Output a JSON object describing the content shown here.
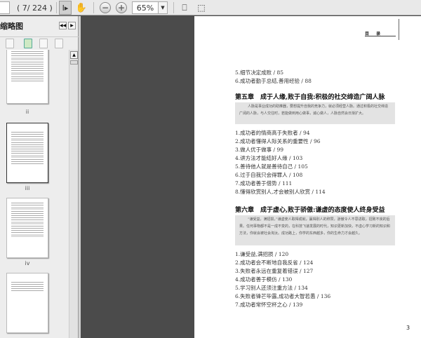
{
  "toolbar": {
    "page_indicator": "( 7/ 224 )",
    "zoom": "65%"
  },
  "panel": {
    "title": "缩略图",
    "thumb_labels": [
      "ii",
      "iii",
      "iv"
    ]
  },
  "page": {
    "header": "目 录",
    "page_number": "3",
    "items_top": [
      "5.细节决定成败 / 85",
      "6.成功者勤于总结,善用经验 / 88"
    ],
    "chapters": [
      {
        "title": "第五章　成于人缘,败于自我:积极的社交缔造广阔人脉",
        "intro": "人脉是事业成功的助推器，要想提升自我的竞争力，就必须经营人脉。通过积极的社交缔造广阔的人脉，与人交往时，若能做到用心做事，诚心做人，人脉自然会日渐扩大。",
        "items": [
          "1.成功者的情商高于失败者 / 94",
          "2.成功者懂得人际关系的重要性 / 96",
          "3.做人优于做事 / 99",
          "4.讲方法才能结好人缘 / 103",
          "5.善待他人就是善待自己 / 105",
          "6.过于自我只会得罪人 / 108",
          "7.成功者善于借势 / 111",
          "8.懂得欣赏别人,才会被别人欣赏 / 114"
        ]
      },
      {
        "title": "第六章　成于虚心,败于骄傲:谦虚的态度使人终身受益",
        "intro": "“谦受益，满招损，”谦虚使人取得成就，赢得别人的称赞，骄傲令人不思进取，招致不良的后果。任何事物都不是一成不变的，在科技飞速发展的时代，知识更新加快，不虚心学习新的知识和方法，你就会被社会淘汰。成功路上，你学的东西越多，你的生命力才会越久。",
        "items": [
          "1.谦受益,满招损 / 120",
          "2.成功者会不断地自我反省 / 124",
          "3.失败者永远在重复着错误 / 127",
          "4.成功者善于模仿 / 130",
          "5.学习别人还须注重方法 / 134",
          "6.失败者锋芒毕露,成功者大智若愚 / 136",
          "7.成功者常怀空杯之心 / 139"
        ]
      }
    ]
  }
}
